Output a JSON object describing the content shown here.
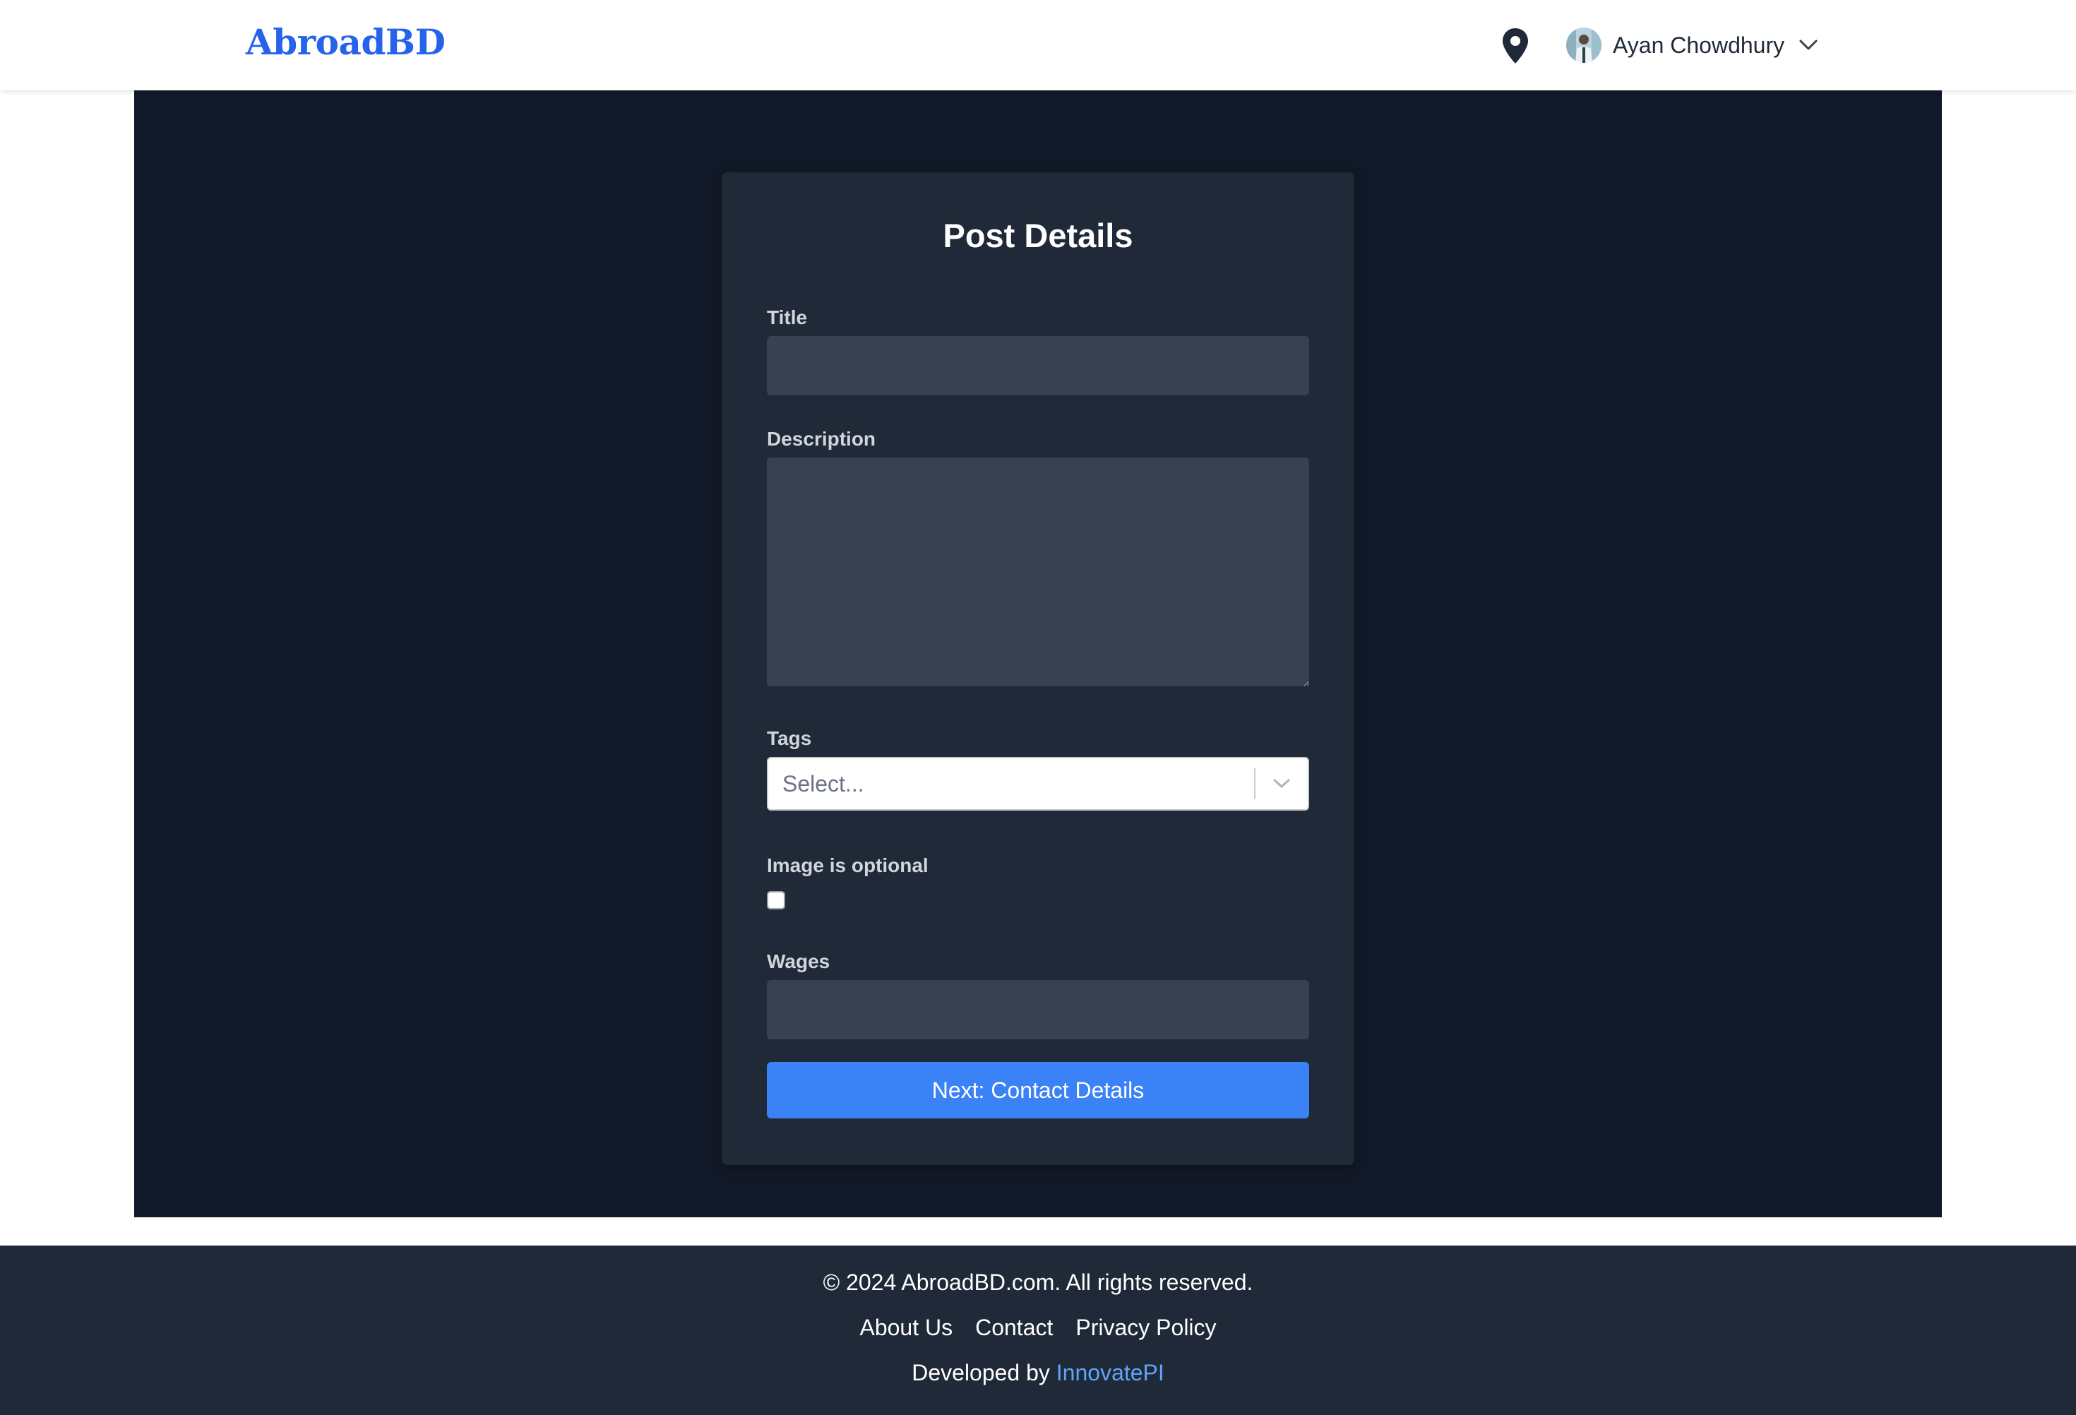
{
  "header": {
    "logo": "AbroadBD",
    "location_icon": "map-pin-icon",
    "user": {
      "name": "Ayan Chowdhury",
      "avatar_icon": "avatar",
      "dropdown_icon": "chevron-down-icon"
    }
  },
  "form": {
    "title": "Post Details",
    "fields": {
      "title": {
        "label": "Title",
        "value": ""
      },
      "description": {
        "label": "Description",
        "value": ""
      },
      "tags": {
        "label": "Tags",
        "placeholder": "Select...",
        "dropdown_icon": "chevron-down-icon"
      },
      "image_optional": {
        "label": "Image is optional",
        "checked": false
      },
      "wages": {
        "label": "Wages",
        "value": ""
      }
    },
    "submit_label": "Next: Contact Details"
  },
  "footer": {
    "copyright": "© 2024 AbroadBD.com. All rights reserved.",
    "links": [
      "About Us",
      "Contact",
      "Privacy Policy"
    ],
    "developed_prefix": "Developed by",
    "developer": "InnovatePI"
  },
  "colors": {
    "brand": "#2563eb",
    "main_bg": "#111827",
    "card_bg": "#1f2937",
    "input_bg": "#374151",
    "button": "#3b82f6",
    "footer_bg": "#1f2937",
    "link_accent": "#60a5fa"
  }
}
